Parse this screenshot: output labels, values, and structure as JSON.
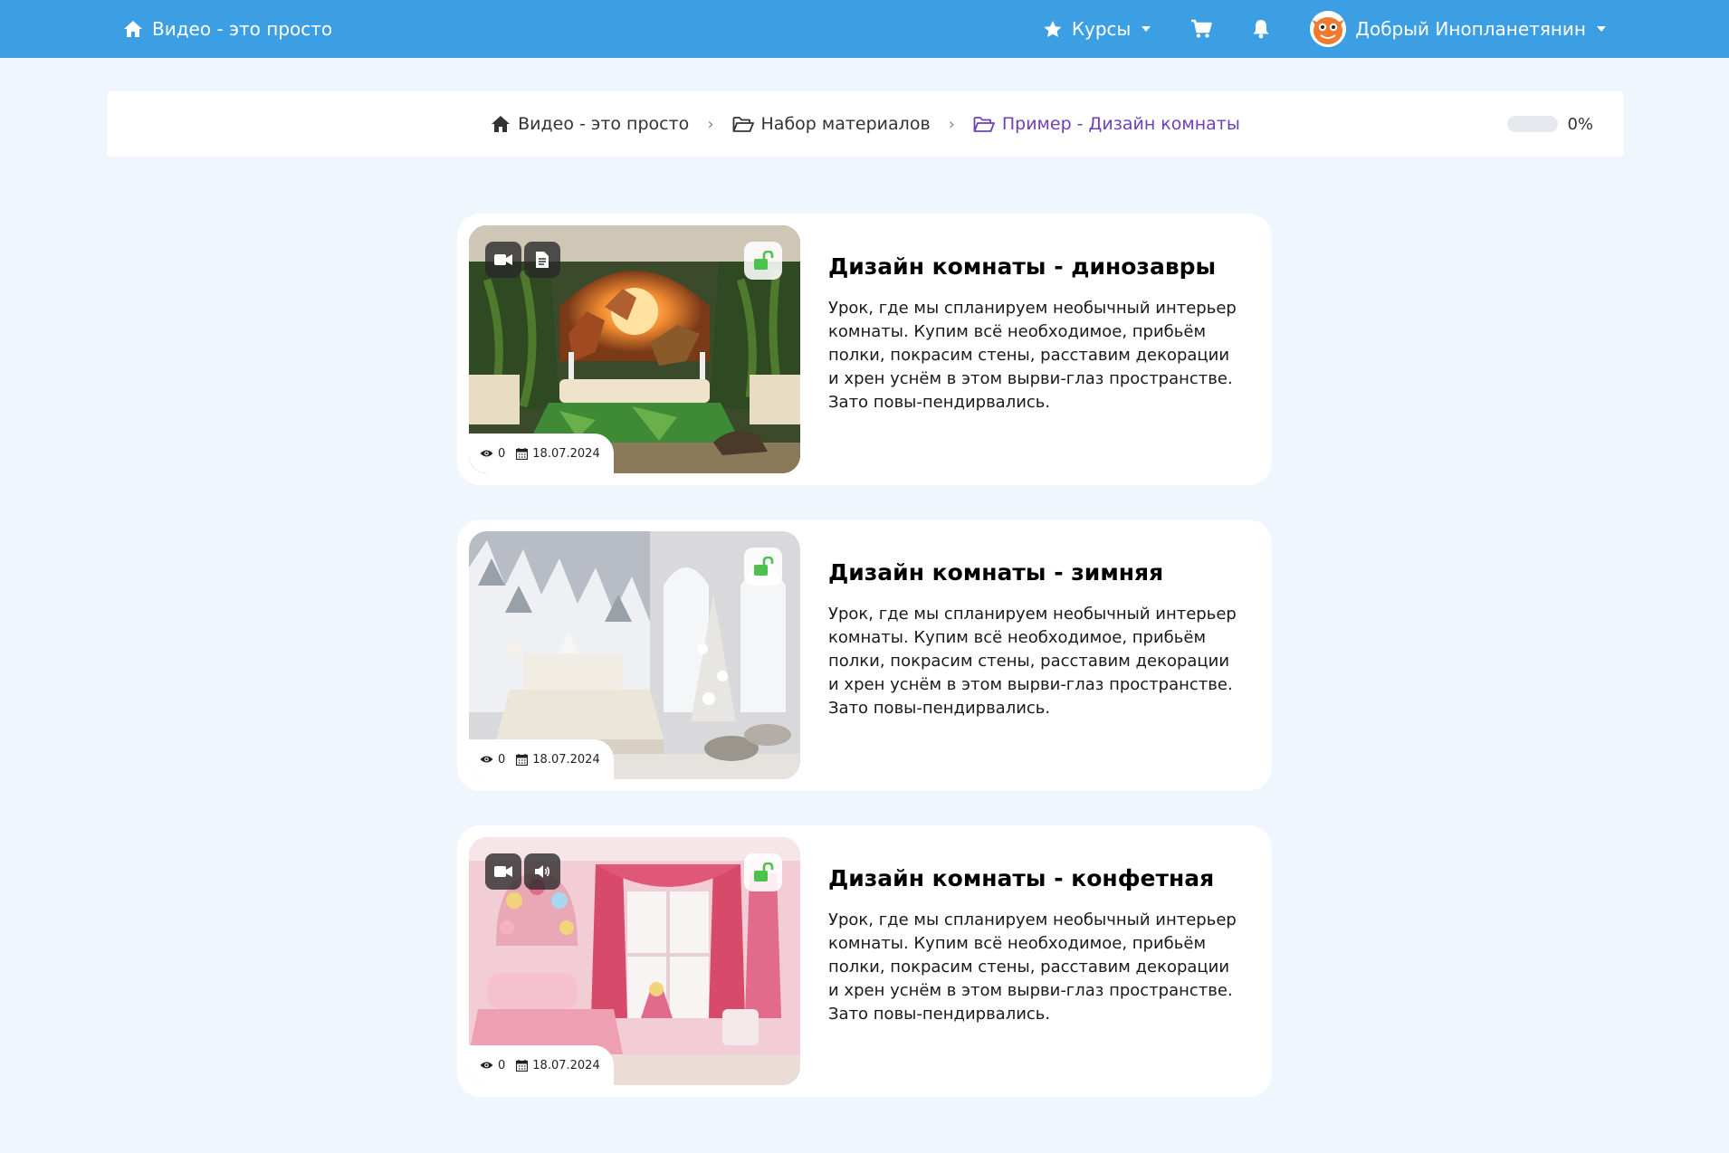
{
  "navbar": {
    "brand_label": "Видео - это просто",
    "courses_label": "Курсы",
    "user_name": "Добрый Инопланетянин"
  },
  "breadcrumb": {
    "items": [
      "Видео - это просто",
      "Набор материалов",
      "Пример - Дизайн комнаты"
    ],
    "progress_text": "0%",
    "progress_value": 0
  },
  "colors": {
    "navbar": "#3c9ee3",
    "background": "#f0f6fd",
    "active_crumb": "#6e3fb8",
    "unlock": "#4cc24c"
  },
  "lessons": [
    {
      "title": "Дизайн комнаты - динозавры",
      "description": "Урок, где мы спланируем необычный интерьер комнаты. Купим всё необходимое, прибьём полки, покрасим стены, расставим декорации и хрен уснём в этом вырви-глаз пространстве. Зато повы-пендирвались.",
      "views": "0",
      "date": "18.07.2024",
      "badges": [
        "video-camera-icon",
        "document-icon"
      ]
    },
    {
      "title": "Дизайн комнаты - зимняя",
      "description": "Урок, где мы спланируем необычный интерьер комнаты. Купим всё необходимое, прибьём полки, покрасим стены, расставим декорации и хрен уснём в этом вырви-глаз пространстве. Зато повы-пендирвались.",
      "views": "0",
      "date": "18.07.2024",
      "badges": []
    },
    {
      "title": "Дизайн комнаты - конфетная",
      "description": "Урок, где мы спланируем необычный интерьер комнаты. Купим всё необходимое, прибьём полки, покрасим стены, расставим декорации и хрен уснём в этом вырви-глаз пространстве. Зато повы-пендирвались.",
      "views": "0",
      "date": "18.07.2024",
      "badges": [
        "video-camera-icon",
        "volume-icon"
      ]
    }
  ]
}
